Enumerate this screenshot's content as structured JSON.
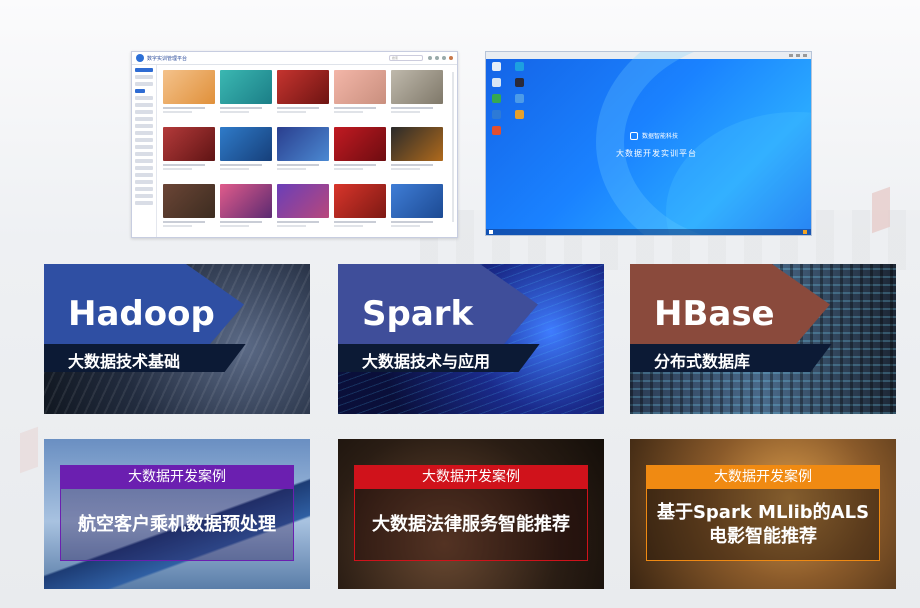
{
  "platform": {
    "title": "数字实训管理平台",
    "search_placeholder": "搜索"
  },
  "desktop": {
    "brand": "数据智能科技",
    "title": "大数据开发实训平台"
  },
  "courses": [
    {
      "name": "Hadoop",
      "subtitle": "大数据技术基础",
      "accent": "#2f4fa3"
    },
    {
      "name": "Spark",
      "subtitle": "大数据技术与应用",
      "accent": "#3f4e9a"
    },
    {
      "name": "HBase",
      "subtitle": "分布式数据库",
      "accent": "#8a4a3c"
    }
  ],
  "cases": [
    {
      "tag": "大数据开发案例",
      "title": "航空客户乘机数据预处理",
      "color": "#6b1fb0"
    },
    {
      "tag": "大数据开发案例",
      "title": "大数据法律服务智能推荐",
      "color": "#d0121b"
    },
    {
      "tag": "大数据开发案例",
      "title": "基于Spark MLlib的ALS电影智能推荐",
      "color": "#f08a12"
    }
  ]
}
